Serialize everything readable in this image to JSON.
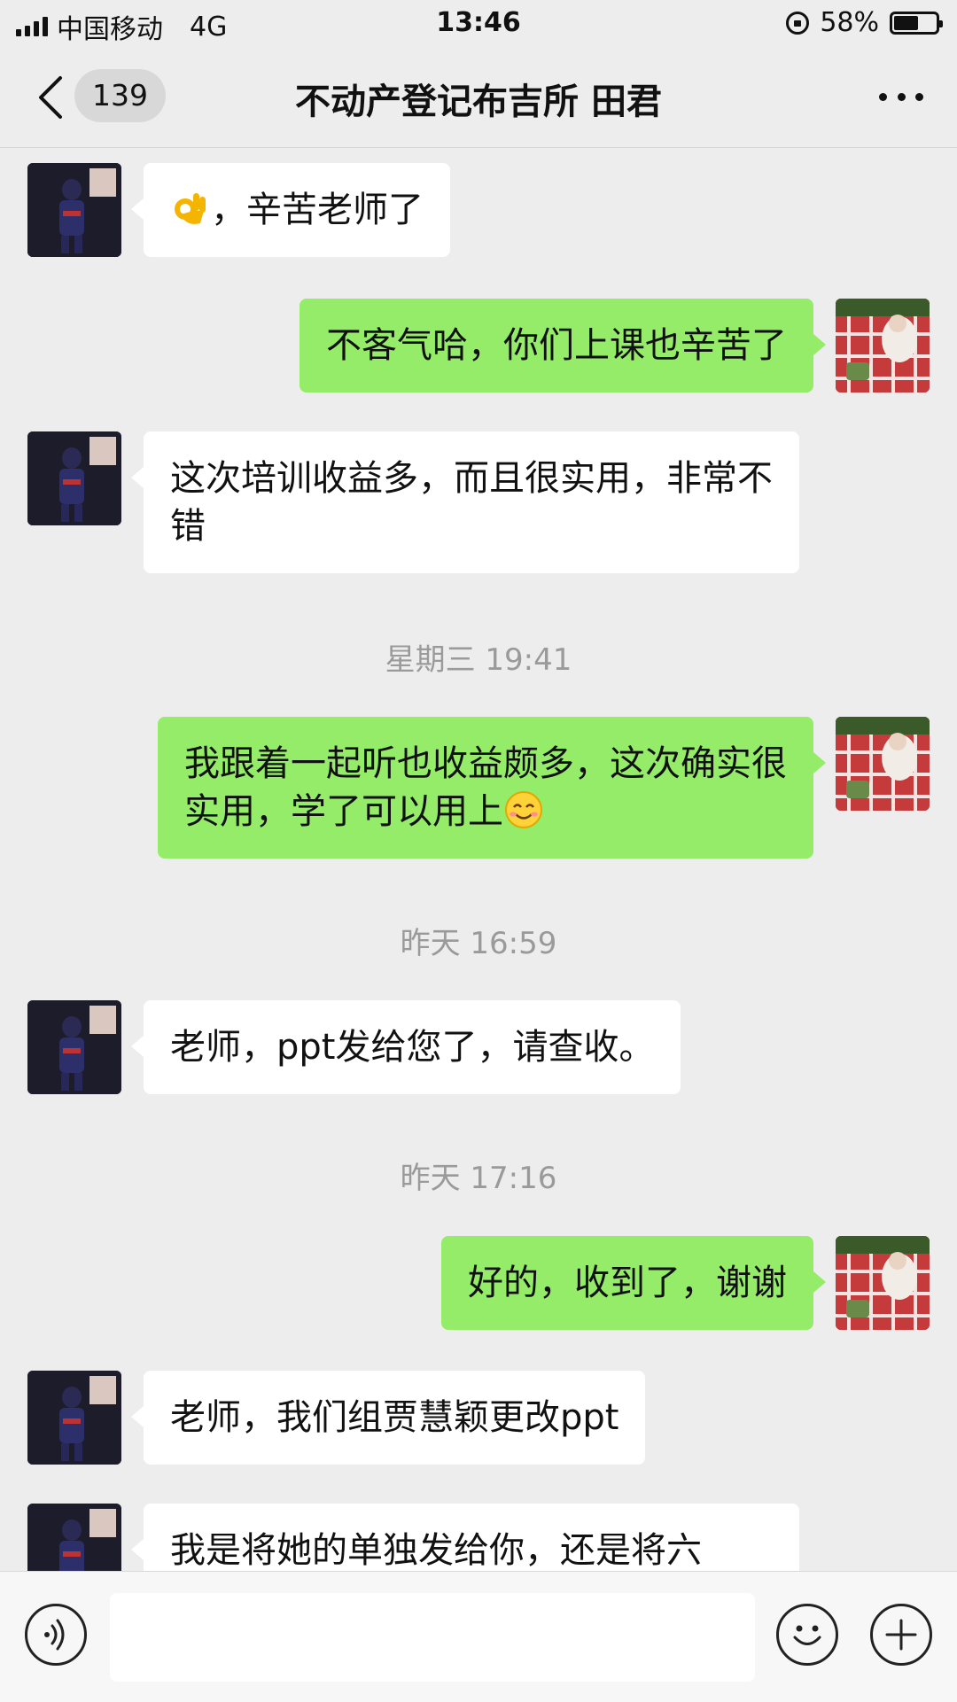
{
  "status_bar": {
    "carrier": "中国移动",
    "network": "4G",
    "time": "13:46",
    "battery_percent": "58%",
    "battery_level": 0.58
  },
  "header": {
    "unread_count": "139",
    "title": "不动产登记布吉所 田君"
  },
  "messages": [
    {
      "sender": "other",
      "text": "，辛苦老师了",
      "emoji_before": "ok-hand-emoji"
    },
    {
      "sender": "self",
      "text": "不客气哈，你们上课也辛苦了"
    },
    {
      "sender": "other",
      "text": "这次培训收益多，而且很实用，非常不错"
    },
    {
      "sender": "self",
      "text": "我跟着一起听也收益颇多，这次确实很实用，学了可以用上",
      "emoji_after": "smiling-face-emoji"
    },
    {
      "sender": "other",
      "text": "老师，ppt发给您了，请查收。"
    },
    {
      "sender": "self",
      "text": "好的，收到了，谢谢"
    },
    {
      "sender": "other",
      "text": "老师，我们组贾慧颖更改ppt"
    },
    {
      "sender": "other",
      "text": "我是将她的单独发给你，还是将六"
    }
  ],
  "timestamps": [
    "星期三 19:41",
    "昨天 16:59",
    "昨天 17:16"
  ],
  "input": {
    "value": "",
    "placeholder": ""
  },
  "colors": {
    "background": "#ededed",
    "self_bubble": "#95ec69",
    "other_bubble": "#ffffff",
    "timestamp_text": "#9a9a9a"
  }
}
